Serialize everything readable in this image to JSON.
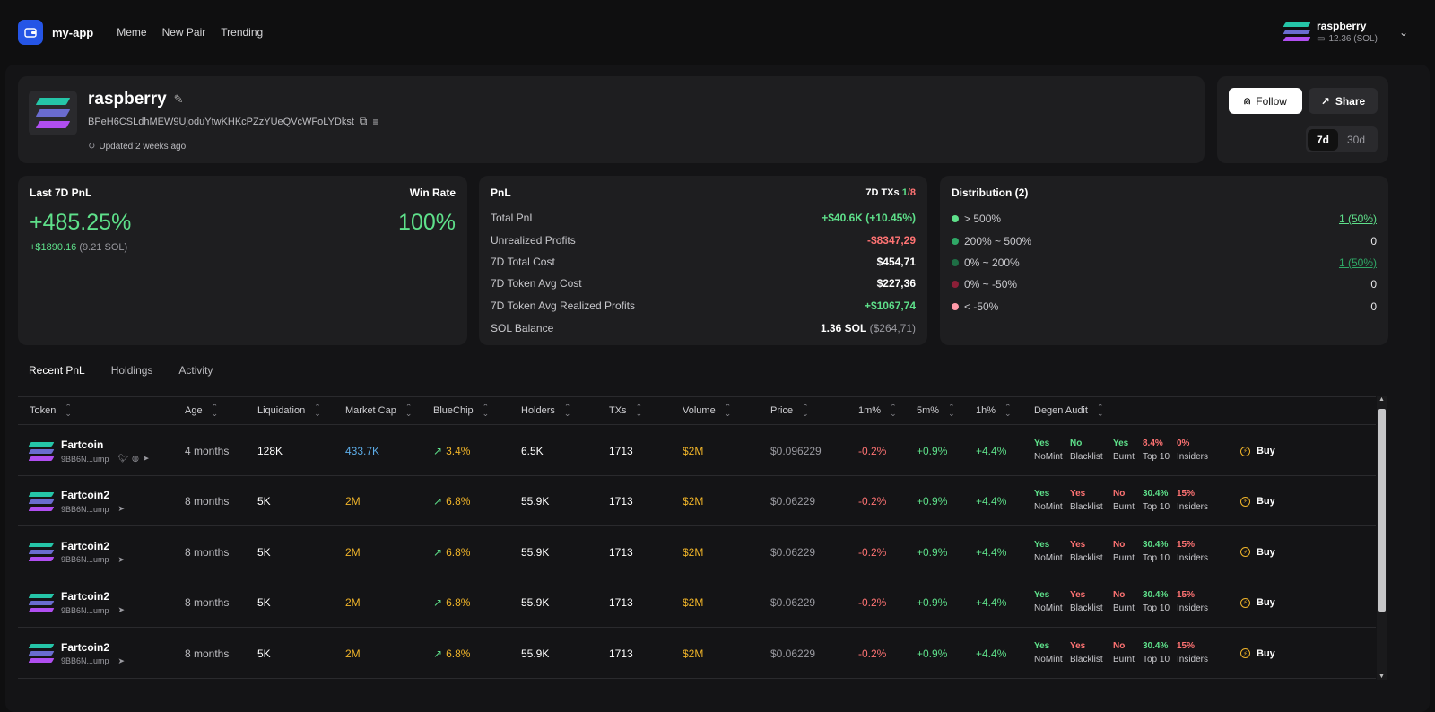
{
  "nav": {
    "brand": "my-app",
    "links": [
      "Meme",
      "New Pair",
      "Trending"
    ]
  },
  "user": {
    "name": "raspberry",
    "balance": "12.36 (SOL)"
  },
  "profile": {
    "name": "raspberry",
    "address": "BPeH6CSLdhMEW9UjoduYtwKHKcPZzYUeQVcWFoLYDkst",
    "updated": "Updated 2 weeks ago"
  },
  "actions": {
    "follow": "Follow",
    "share": "Share",
    "periods": [
      "7d",
      "30d"
    ],
    "active_period": "7d"
  },
  "last7d": {
    "title": "Last 7D PnL",
    "winrate_label": "Win Rate",
    "pnl_pct": "+485.25%",
    "winrate": "100%",
    "pnl_usd": "+$1890.16",
    "pnl_sol": "(9.21 SOL)"
  },
  "pnl": {
    "title": "PnL",
    "txs_label": "7D TXs",
    "txs_win": "1",
    "txs_total": "/8",
    "rows": [
      {
        "label": "Total PnL",
        "value": "+$40.6K (+10.45%)",
        "color": "green"
      },
      {
        "label": "Unrealized Profits",
        "value": "-$8347,29",
        "color": "red"
      },
      {
        "label": "7D Total Cost",
        "value": "$454,71",
        "color": "white"
      },
      {
        "label": "7D Token Avg Cost",
        "value": "$227,36",
        "color": "white"
      },
      {
        "label": "7D Token Avg Realized Profits",
        "value": "+$1067,74",
        "color": "green"
      }
    ],
    "sol_label": "SOL Balance",
    "sol_value": "1.36 SOL",
    "sol_usd": "($264,71)"
  },
  "distribution": {
    "title": "Distribution (2)",
    "rows": [
      {
        "label": "> 500%",
        "value": "1 (50%)",
        "dot": "#5ee08a",
        "vcolor": "#5ee08a",
        "link": true
      },
      {
        "label": "200% ~ 500%",
        "value": "0",
        "dot": "#2fa866",
        "vcolor": "#e8e8ea",
        "link": false
      },
      {
        "label": "0% ~ 200%",
        "value": "1 (50%)",
        "dot": "#1f6f45",
        "vcolor": "#2fa866",
        "link": true
      },
      {
        "label": "0% ~ -50%",
        "value": "0",
        "dot": "#8c1f37",
        "vcolor": "#e8e8ea",
        "link": false
      },
      {
        "label": "< -50%",
        "value": "0",
        "dot": "#ff9aa8",
        "vcolor": "#e8e8ea",
        "link": false
      }
    ]
  },
  "tabs": [
    "Recent PnL",
    "Holdings",
    "Activity"
  ],
  "columns": [
    "Token",
    "Age",
    "Liquidation",
    "Market Cap",
    "BlueChip",
    "Holders",
    "TXs",
    "Volume",
    "Price",
    "1m%",
    "5m%",
    "1h%",
    "Degen Audit"
  ],
  "audit_keys": [
    "NoMint",
    "Blacklist",
    "Burnt",
    "Top 10",
    "Insiders"
  ],
  "buy_label": "Buy",
  "rows": [
    {
      "name": "Fartcoin",
      "addr": "9BB6N...ump",
      "socials": 3,
      "age": "4 months",
      "liq": "128K",
      "mcap": "433.7K",
      "mcap_color": "cyan",
      "bluechip": "3.4%",
      "holders": "6.5K",
      "txs": "1713",
      "volume": "$2M",
      "price": "$0.096229",
      "m1": "-0.2%",
      "m5": "+0.9%",
      "h1": "+4.4%",
      "audit": [
        {
          "v": "Yes",
          "c": "green"
        },
        {
          "v": "No",
          "c": "green"
        },
        {
          "v": "Yes",
          "c": "green"
        },
        {
          "v": "8.4%",
          "c": "red"
        },
        {
          "v": "0%",
          "c": "red"
        }
      ]
    },
    {
      "name": "Fartcoin2",
      "addr": "9BB6N...ump",
      "socials": 1,
      "age": "8 months",
      "liq": "5K",
      "mcap": "2M",
      "mcap_color": "gold",
      "bluechip": "6.8%",
      "holders": "55.9K",
      "txs": "1713",
      "volume": "$2M",
      "price": "$0.06229",
      "m1": "-0.2%",
      "m5": "+0.9%",
      "h1": "+4.4%",
      "audit": [
        {
          "v": "Yes",
          "c": "green"
        },
        {
          "v": "Yes",
          "c": "red"
        },
        {
          "v": "No",
          "c": "red"
        },
        {
          "v": "30.4%",
          "c": "green"
        },
        {
          "v": "15%",
          "c": "red"
        }
      ]
    },
    {
      "name": "Fartcoin2",
      "addr": "9BB6N...ump",
      "socials": 1,
      "age": "8 months",
      "liq": "5K",
      "mcap": "2M",
      "mcap_color": "gold",
      "bluechip": "6.8%",
      "holders": "55.9K",
      "txs": "1713",
      "volume": "$2M",
      "price": "$0.06229",
      "m1": "-0.2%",
      "m5": "+0.9%",
      "h1": "+4.4%",
      "audit": [
        {
          "v": "Yes",
          "c": "green"
        },
        {
          "v": "Yes",
          "c": "red"
        },
        {
          "v": "No",
          "c": "red"
        },
        {
          "v": "30.4%",
          "c": "green"
        },
        {
          "v": "15%",
          "c": "red"
        }
      ]
    },
    {
      "name": "Fartcoin2",
      "addr": "9BB6N...ump",
      "socials": 1,
      "age": "8 months",
      "liq": "5K",
      "mcap": "2M",
      "mcap_color": "gold",
      "bluechip": "6.8%",
      "holders": "55.9K",
      "txs": "1713",
      "volume": "$2M",
      "price": "$0.06229",
      "m1": "-0.2%",
      "m5": "+0.9%",
      "h1": "+4.4%",
      "audit": [
        {
          "v": "Yes",
          "c": "green"
        },
        {
          "v": "Yes",
          "c": "red"
        },
        {
          "v": "No",
          "c": "red"
        },
        {
          "v": "30.4%",
          "c": "green"
        },
        {
          "v": "15%",
          "c": "red"
        }
      ]
    },
    {
      "name": "Fartcoin2",
      "addr": "9BB6N...ump",
      "socials": 1,
      "age": "8 months",
      "liq": "5K",
      "mcap": "2M",
      "mcap_color": "gold",
      "bluechip": "6.8%",
      "holders": "55.9K",
      "txs": "1713",
      "volume": "$2M",
      "price": "$0.06229",
      "m1": "-0.2%",
      "m5": "+0.9%",
      "h1": "+4.4%",
      "audit": [
        {
          "v": "Yes",
          "c": "green"
        },
        {
          "v": "Yes",
          "c": "red"
        },
        {
          "v": "No",
          "c": "red"
        },
        {
          "v": "30.4%",
          "c": "green"
        },
        {
          "v": "15%",
          "c": "red"
        }
      ]
    }
  ]
}
